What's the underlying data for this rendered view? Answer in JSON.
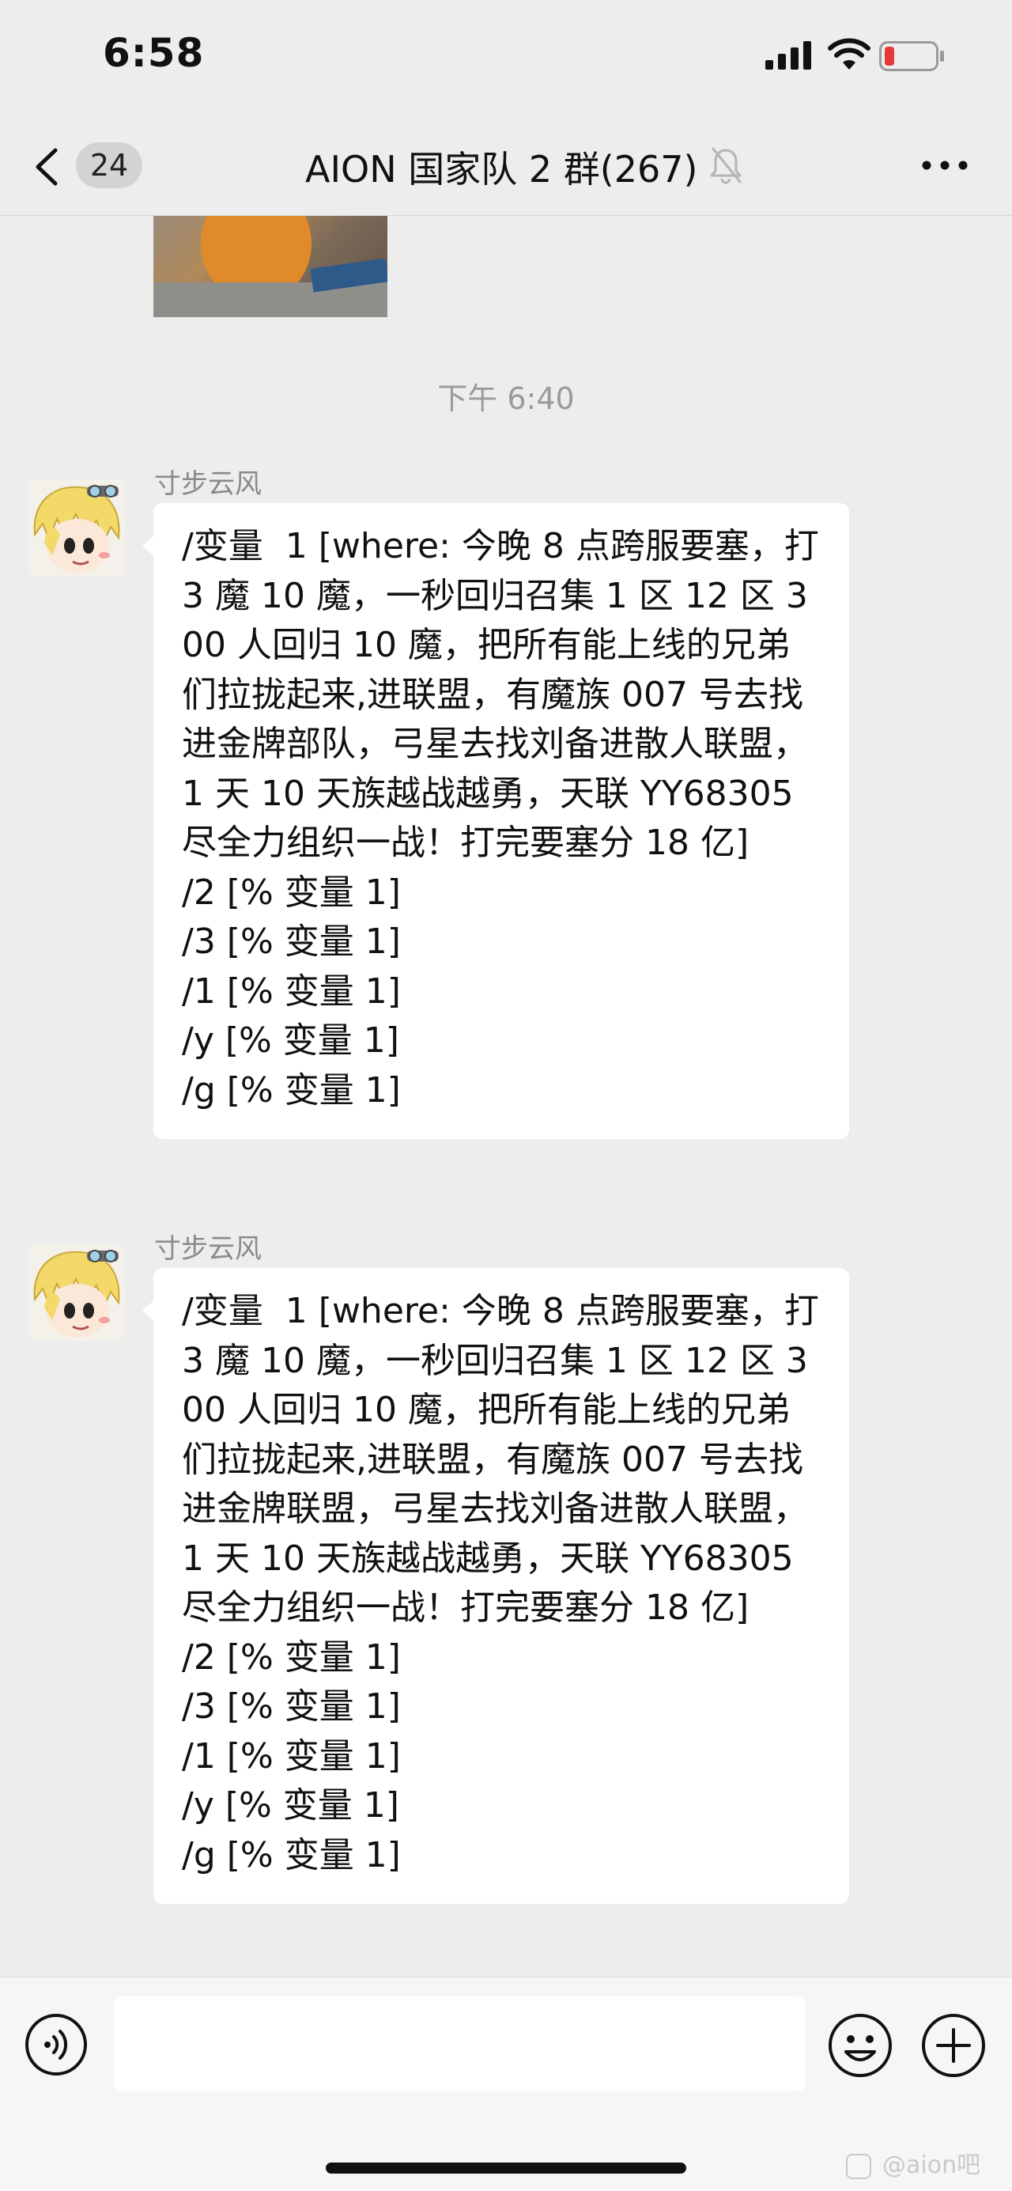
{
  "status_bar": {
    "time": "6:58",
    "battery_color": "#e53935"
  },
  "nav": {
    "unread_count": "24",
    "title": "AION 国家队 2 群(267)"
  },
  "chat": {
    "timestamp": "下午 6:40",
    "messages": [
      {
        "sender": "寸步云风",
        "text": "/变量  1 [where: 今晚 8 点跨服要塞，打 3 魔 10 魔，一秒回归召集 1 区 12 区 300 人回归 10 魔，把所有能上线的兄弟们拉拢起来,进联盟，有魔族 007 号去找进金牌部队，弓星去找刘备进散人联盟，1 天 10 天族越战越勇，天联 YY68305 尽全力组织一战！打完要塞分 18 亿]\n/2 [% 变量 1]\n/3 [% 变量 1]\n/1 [% 变量 1]\n/y [% 变量 1]\n/g [% 变量 1]"
      },
      {
        "sender": "寸步云风",
        "text": "/变量  1 [where: 今晚 8 点跨服要塞，打 3 魔 10 魔，一秒回归召集 1 区 12 区 300 人回归 10 魔，把所有能上线的兄弟们拉拢起来,进联盟，有魔族 007 号去找进金牌联盟，弓星去找刘备进散人联盟，1 天 10 天族越战越勇，天联 YY68305 尽全力组织一战！打完要塞分 18 亿]\n/2 [% 变量 1]\n/3 [% 变量 1]\n/1 [% 变量 1]\n/y [% 变量 1]\n/g [% 变量 1]"
      }
    ]
  },
  "input_bar": {
    "placeholder": ""
  },
  "watermark": "@aion吧"
}
